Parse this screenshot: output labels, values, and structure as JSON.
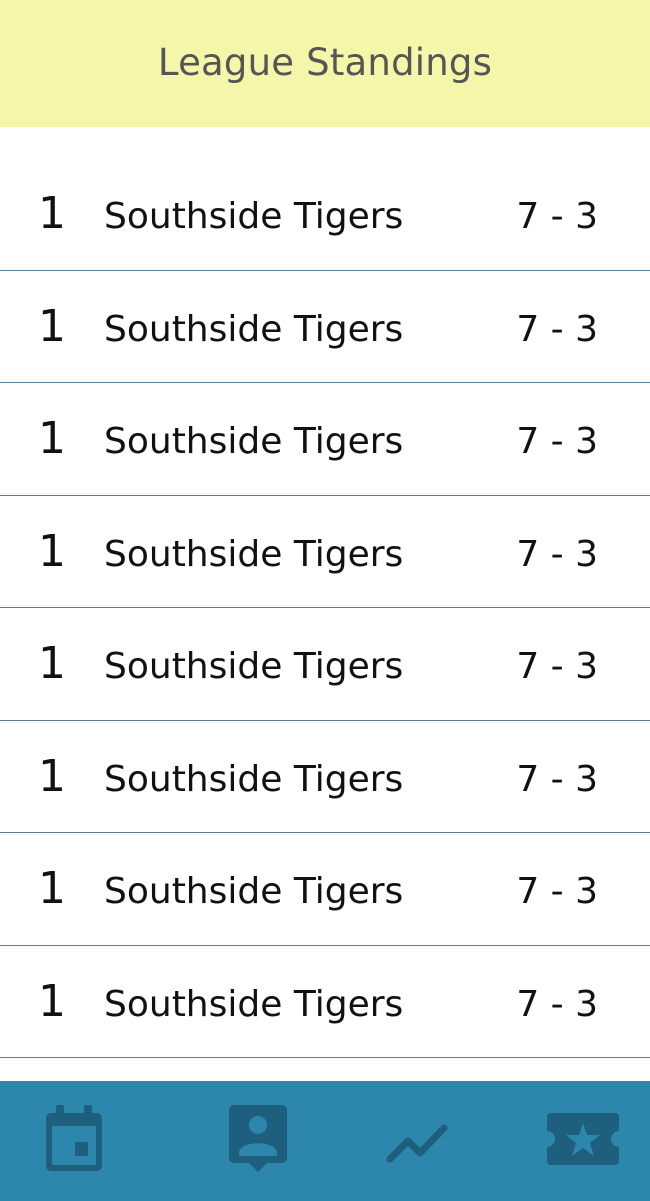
{
  "header": {
    "title": "League Standings"
  },
  "standings": [
    {
      "rank": "1",
      "team": "Southside Tigers",
      "record": "7 - 3"
    },
    {
      "rank": "1",
      "team": "Southside Tigers",
      "record": "7 - 3"
    },
    {
      "rank": "1",
      "team": "Southside Tigers",
      "record": "7 - 3"
    },
    {
      "rank": "1",
      "team": "Southside Tigers",
      "record": "7 - 3"
    },
    {
      "rank": "1",
      "team": "Southside Tigers",
      "record": "7 - 3"
    },
    {
      "rank": "1",
      "team": "Southside Tigers",
      "record": "7 - 3"
    },
    {
      "rank": "1",
      "team": "Southside Tigers",
      "record": "7 - 3"
    },
    {
      "rank": "1",
      "team": "Southside Tigers",
      "record": "7 - 3"
    }
  ],
  "tabbar": {
    "tabs": [
      {
        "icon": "calendar-icon"
      },
      {
        "icon": "contact-card-icon"
      },
      {
        "icon": "trending-icon"
      },
      {
        "icon": "ticket-star-icon"
      }
    ]
  },
  "colors": {
    "header_bg": "#f6f6ab",
    "tabbar_bg": "#2d86ab",
    "icon": "#1d5f7d",
    "divider": "#5b7d96"
  }
}
